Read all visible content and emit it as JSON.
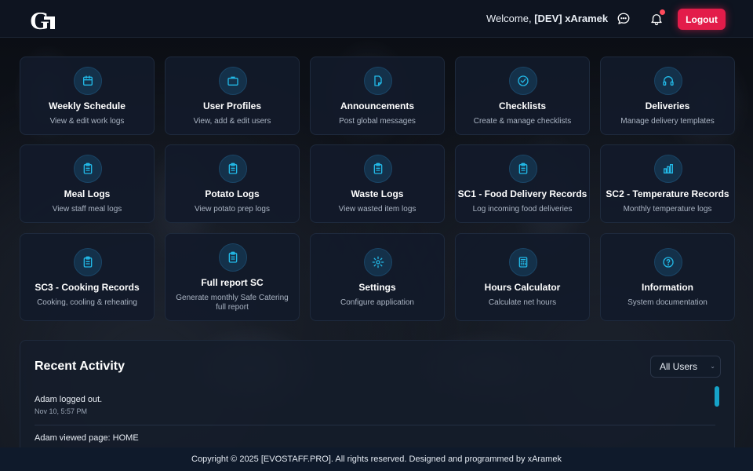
{
  "header": {
    "logo_text": "G",
    "welcome_prefix": "Welcome,",
    "username": "[DEV] xAramek",
    "logout_label": "Logout",
    "has_notification": true
  },
  "tiles": [
    {
      "title": "Weekly Schedule",
      "subtitle": "View & edit work logs",
      "icon": "calendar-icon"
    },
    {
      "title": "User Profiles",
      "subtitle": "View, add & edit users",
      "icon": "briefcase-icon"
    },
    {
      "title": "Announcements",
      "subtitle": "Post global messages",
      "icon": "document-icon"
    },
    {
      "title": "Checklists",
      "subtitle": "Create & manage checklists",
      "icon": "check-circle-icon"
    },
    {
      "title": "Deliveries",
      "subtitle": "Manage delivery templates",
      "icon": "headset-icon"
    },
    {
      "title": "Meal Logs",
      "subtitle": "View staff meal logs",
      "icon": "clipboard-icon"
    },
    {
      "title": "Potato Logs",
      "subtitle": "View potato prep logs",
      "icon": "clipboard-icon"
    },
    {
      "title": "Waste Logs",
      "subtitle": "View wasted item logs",
      "icon": "clipboard-icon"
    },
    {
      "title": "SC1 - Food Delivery Records",
      "subtitle": "Log incoming food deliveries",
      "icon": "clipboard-icon"
    },
    {
      "title": "SC2 - Temperature Records",
      "subtitle": "Monthly temperature logs",
      "icon": "bar-chart-icon"
    },
    {
      "title": "SC3 - Cooking Records",
      "subtitle": "Cooking, cooling & reheating",
      "icon": "clipboard-icon"
    },
    {
      "title": "Full report SC",
      "subtitle": "Generate monthly Safe Catering full report",
      "icon": "clipboard-icon"
    },
    {
      "title": "Settings",
      "subtitle": "Configure application",
      "icon": "gear-icon"
    },
    {
      "title": "Hours Calculator",
      "subtitle": "Calculate net hours",
      "icon": "calculator-icon"
    },
    {
      "title": "Information",
      "subtitle": "System documentation",
      "icon": "question-circle-icon"
    }
  ],
  "activity": {
    "title": "Recent Activity",
    "filter_selected": "All Users",
    "items": [
      {
        "text": "Adam logged out.",
        "time": "Nov 10, 5:57 PM"
      },
      {
        "text": "Adam viewed page: HOME",
        "time": ""
      }
    ]
  },
  "footer": {
    "text": "Copyright © 2025 [EVOSTAFF.PRO]. All rights reserved. Designed and programmed by xAramek"
  },
  "colors": {
    "accent": "#22b8e6",
    "logout": "#e31c4a",
    "tile_bg": "#121a2a",
    "scrollbar": "#16a3c8"
  }
}
